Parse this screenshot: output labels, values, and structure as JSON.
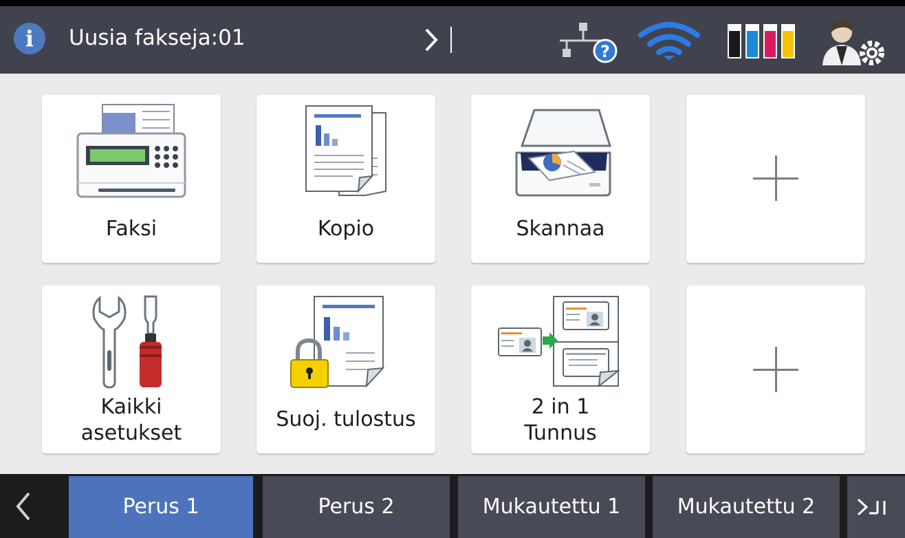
{
  "header": {
    "notification_text": "Uusia fakseja:01",
    "info_icon_glyph": "i"
  },
  "status_icons": [
    "wired-lan-unknown-icon",
    "wifi-icon",
    "ink-levels-icon",
    "admin-settings-icon"
  ],
  "ink_colors": [
    "#1a1a1a",
    "#1a8ad6",
    "#d81b60",
    "#f5c400"
  ],
  "tiles": [
    {
      "label": "Faksi",
      "icon": "fax-icon"
    },
    {
      "label": "Kopio",
      "icon": "copy-icon"
    },
    {
      "label": "Skannaa",
      "icon": "scan-icon"
    },
    {
      "label": "",
      "icon": "plus-icon"
    },
    {
      "label_lines": [
        "Kaikki",
        "asetukset"
      ],
      "icon": "tools-icon"
    },
    {
      "label": "Suoj. tulostus",
      "icon": "secure-print-icon"
    },
    {
      "label_lines": [
        "2 in 1",
        "Tunnus"
      ],
      "icon": "id-copy-icon"
    },
    {
      "label": "",
      "icon": "plus-icon"
    }
  ],
  "tabs": [
    {
      "label": "Perus 1",
      "active": true
    },
    {
      "label": "Perus 2",
      "active": false
    },
    {
      "label": "Mukautettu 1",
      "active": false
    },
    {
      "label": "Mukautettu 2",
      "active": false
    }
  ],
  "colors": {
    "header_bg": "#40424d",
    "accent_blue": "#4c79c0",
    "tab_active": "#4d73bd",
    "tab_inactive": "#484a55"
  }
}
